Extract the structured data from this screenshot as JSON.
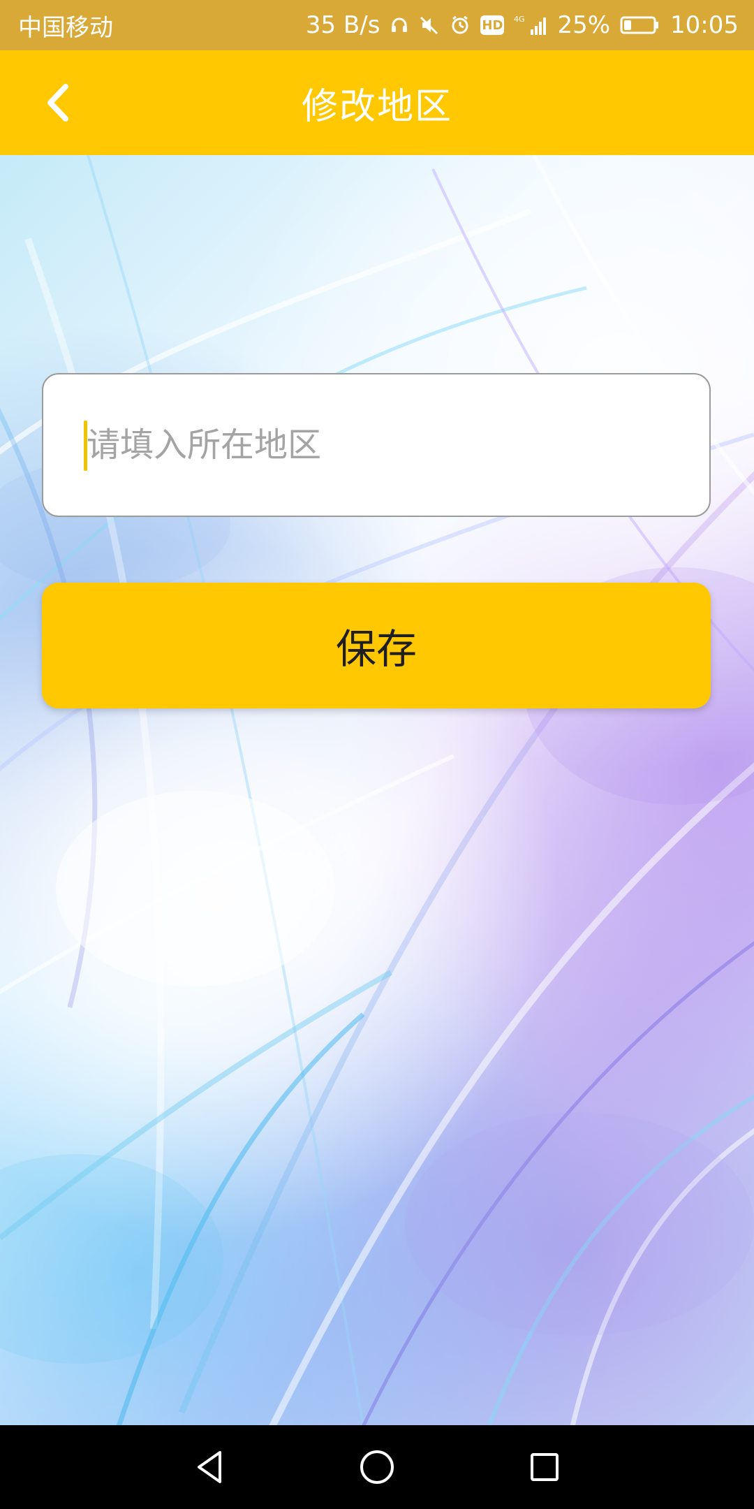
{
  "status_bar": {
    "carrier": "中国移动",
    "network_speed": "35 B/s",
    "battery_percent": "25%",
    "time": "10:05",
    "battery_level": 0.25,
    "icons": {
      "headphones": "headphones-icon",
      "mute": "mute-icon",
      "alarm": "alarm-icon",
      "hd": "HD",
      "network": "4G",
      "signal": "signal-icon",
      "battery": "battery-icon"
    }
  },
  "app_bar": {
    "title": "修改地区",
    "back_icon": "chevron-left-icon",
    "background": "#ffc800",
    "text_color": "#ffffff"
  },
  "form": {
    "region_input": {
      "value": "",
      "placeholder": "请填入所在地区"
    },
    "save_button_label": "保存"
  },
  "navigation_bar": {
    "back_icon": "triangle-back-icon",
    "home_icon": "circle-home-icon",
    "recent_icon": "square-recent-icon"
  },
  "colors": {
    "status_bar": "#d9a938",
    "accent": "#ffc800",
    "placeholder": "#a4a4a4"
  }
}
